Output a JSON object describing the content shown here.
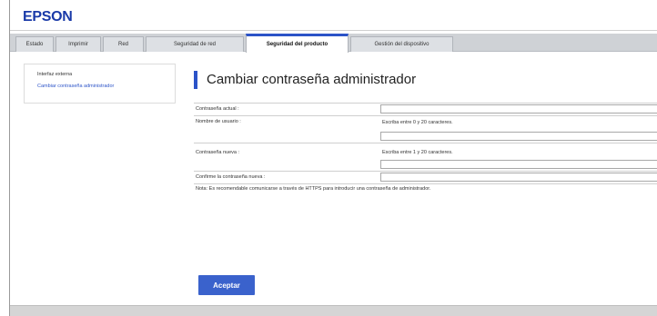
{
  "brand": {
    "logo": "EPSON",
    "accent": "#2b53c8"
  },
  "tabs": [
    {
      "label": "Estado"
    },
    {
      "label": "Imprimir"
    },
    {
      "label": "Red"
    },
    {
      "label": "Seguridad de red"
    },
    {
      "label": "Seguridad del producto",
      "active": true
    },
    {
      "label": "Gestión del dispositivo"
    }
  ],
  "sidebar": {
    "items": [
      {
        "label": "Interfaz externa"
      },
      {
        "label": "Cambiar contraseña administrador",
        "selected": true
      }
    ]
  },
  "main": {
    "title": "Cambiar contraseña administrador",
    "fields": {
      "current_password": {
        "label": "Contraseña actual :",
        "value": ""
      },
      "username": {
        "label": "Nombre de usuario :",
        "hint": "Escriba entre 0 y 20 caracteres.",
        "value": ""
      },
      "new_password": {
        "label": "Contraseña nueva :",
        "hint": "Escriba entre 1 y 20 caracteres.",
        "value": ""
      },
      "confirm_password": {
        "label": "Confirme la contraseña nueva :",
        "value": ""
      }
    },
    "note": "Nota: Es recomendable comunicarse a través de HTTPS para introducir una contraseña de administrador.",
    "submit_label": "Aceptar"
  }
}
